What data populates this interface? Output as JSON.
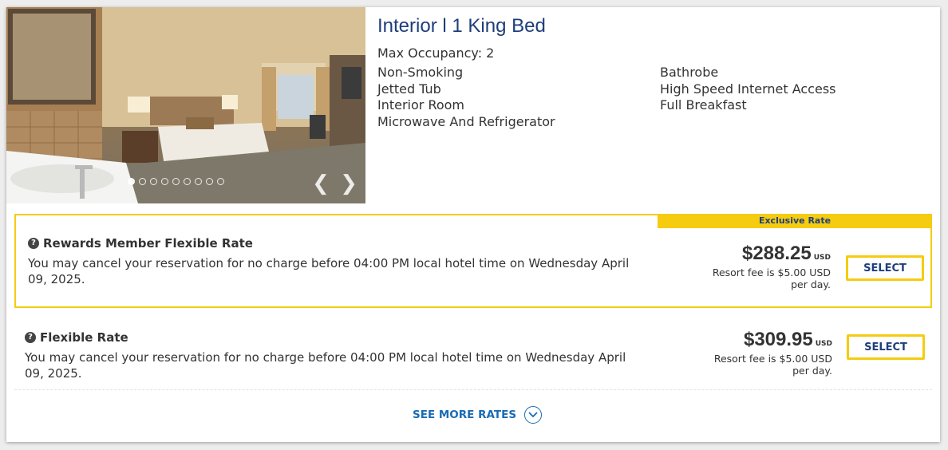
{
  "room": {
    "title": "Interior l 1 King Bed",
    "max_occupancy": "Max Occupancy: 2",
    "amenities_col1": [
      "Non-Smoking",
      "Jetted Tub",
      "Interior Room",
      "Microwave And Refrigerator"
    ],
    "amenities_col2": [
      "Bathrobe",
      "High Speed Internet Access",
      "Full Breakfast"
    ]
  },
  "gallery": {
    "slide_count": 9,
    "active_index": 0,
    "prev_icon": "chevron-left-icon",
    "next_icon": "chevron-right-icon"
  },
  "rates": [
    {
      "badge": "Exclusive Rate",
      "name": "Rewards Member Flexible Rate",
      "description": "You may cancel your reservation for no charge before 04:00 PM local hotel time on Wednesday April 09, 2025.",
      "price": "$288.25",
      "currency": "USD",
      "fee_line1": "Resort fee is $5.00 USD",
      "fee_line2": "per day.",
      "button": "SELECT"
    },
    {
      "name": "Flexible Rate",
      "description": "You may cancel your reservation for no charge before 04:00 PM local hotel time on Wednesday April 09, 2025.",
      "price": "$309.95",
      "currency": "USD",
      "fee_line1": "Resort fee is $5.00 USD",
      "fee_line2": "per day.",
      "button": "SELECT"
    }
  ],
  "see_more": {
    "label": "SEE MORE RATES",
    "icon": "chevron-down-circle-icon"
  },
  "colors": {
    "title_blue": "#1e3e7a",
    "accent_yellow": "#f5cc10",
    "link_blue": "#1a6bb5"
  }
}
